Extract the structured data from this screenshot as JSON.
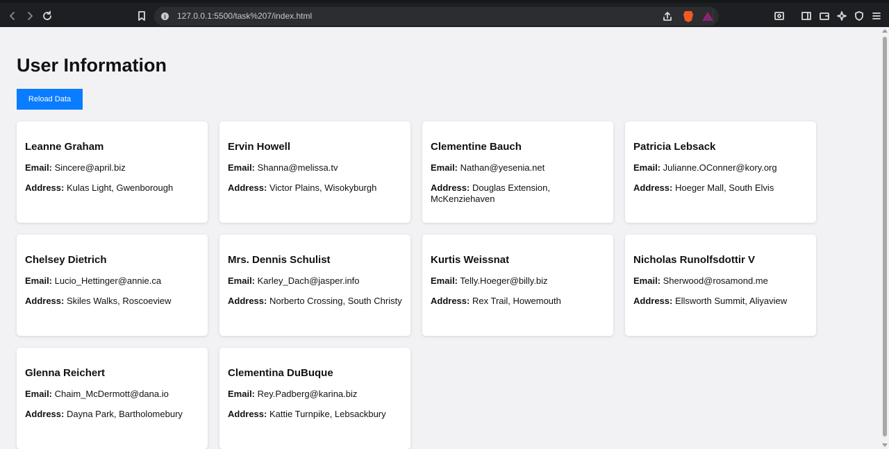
{
  "browser": {
    "url": "127.0.0.1:5500/task%207/index.html"
  },
  "page": {
    "title": "User Information",
    "reload_label": "Reload Data"
  },
  "labels": {
    "email": "Email:",
    "address": "Address:"
  },
  "users": [
    {
      "name": "Leanne Graham",
      "email": "Sincere@april.biz",
      "address": "Kulas Light, Gwenborough"
    },
    {
      "name": "Ervin Howell",
      "email": "Shanna@melissa.tv",
      "address": "Victor Plains, Wisokyburgh"
    },
    {
      "name": "Clementine Bauch",
      "email": "Nathan@yesenia.net",
      "address": "Douglas Extension, McKenziehaven"
    },
    {
      "name": "Patricia Lebsack",
      "email": "Julianne.OConner@kory.org",
      "address": "Hoeger Mall, South Elvis"
    },
    {
      "name": "Chelsey Dietrich",
      "email": "Lucio_Hettinger@annie.ca",
      "address": "Skiles Walks, Roscoeview"
    },
    {
      "name": "Mrs. Dennis Schulist",
      "email": "Karley_Dach@jasper.info",
      "address": "Norberto Crossing, South Christy"
    },
    {
      "name": "Kurtis Weissnat",
      "email": "Telly.Hoeger@billy.biz",
      "address": "Rex Trail, Howemouth"
    },
    {
      "name": "Nicholas Runolfsdottir V",
      "email": "Sherwood@rosamond.me",
      "address": "Ellsworth Summit, Aliyaview"
    },
    {
      "name": "Glenna Reichert",
      "email": "Chaim_McDermott@dana.io",
      "address": "Dayna Park, Bartholomebury"
    },
    {
      "name": "Clementina DuBuque",
      "email": "Rey.Padberg@karina.biz",
      "address": "Kattie Turnpike, Lebsackbury"
    }
  ]
}
